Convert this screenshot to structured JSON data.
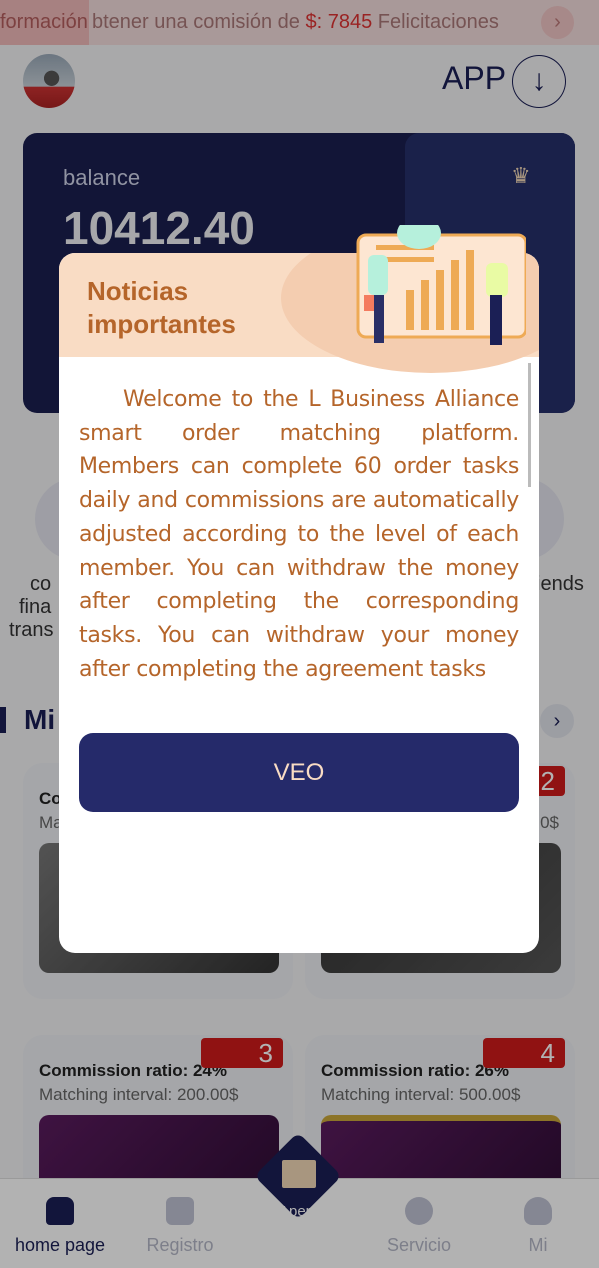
{
  "marquee": {
    "label": "formación",
    "text_pre": "btener una comisión de ",
    "amount": "$: 7845",
    "text_post": " Felicitaciones"
  },
  "header": {
    "app_label": "APP"
  },
  "balance": {
    "label": "balance",
    "value": "10412.40"
  },
  "quick": {
    "left_lines": [
      "co",
      "fina",
      "trans"
    ],
    "right_label": "iends"
  },
  "section": {
    "title": "Mi"
  },
  "cards": [
    {
      "title": "Co",
      "sub": "Ma",
      "badge": ""
    },
    {
      "title": "",
      "sub": "0$",
      "badge": "2"
    },
    {
      "title": "Commission ratio: 24%",
      "sub": "Matching interval:  200.00$",
      "badge": "3"
    },
    {
      "title": "Commission ratio: 26%",
      "sub": "Matching interval:  500.00$",
      "badge": "4"
    }
  ],
  "nav": {
    "items": [
      {
        "label": "home page",
        "active": true
      },
      {
        "label": "Registro"
      },
      {
        "label": "Apero"
      },
      {
        "label": "Servicio"
      },
      {
        "label": "Mi"
      }
    ]
  },
  "modal": {
    "title": "Noticias importantes",
    "body": "Welcome to the L Business Alliance smart order matching platform. Members can complete 60 order tasks daily and commissions are automatically adjusted according to the level of each member. You can withdraw the money after completing the corresponding tasks. You can withdraw your money after completing the agreement tasks",
    "button": "VEO"
  },
  "colors": {
    "navy": "#1b1f55",
    "button": "#252a6a",
    "modal_header": "#f9dcc4",
    "modal_text": "#b5652a",
    "badge": "#cf1b1b"
  }
}
